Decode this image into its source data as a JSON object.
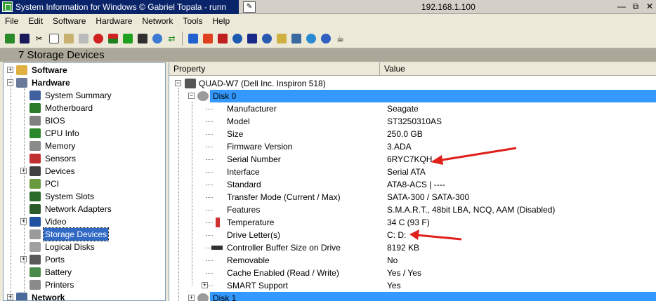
{
  "window": {
    "title": "System Information for Windows  © Gabriel Topala - runn",
    "pin_icon": "pin-icon",
    "remote_address": "192.168.1.100",
    "minimize_glyph": "—",
    "restore_glyph": "⧉",
    "close_glyph": "✕"
  },
  "menu": [
    "File",
    "Edit",
    "Software",
    "Hardware",
    "Network",
    "Tools",
    "Help"
  ],
  "caption": "7 Storage Devices",
  "tree": {
    "items": [
      {
        "label": "Software",
        "bold": true,
        "icon": "software-icon"
      },
      {
        "label": "Hardware",
        "bold": true,
        "icon": "hardware-icon"
      },
      {
        "label": "System Summary",
        "icon": "computer-icon"
      },
      {
        "label": "Motherboard",
        "icon": "motherboard-icon"
      },
      {
        "label": "BIOS",
        "icon": "bios-chip-icon"
      },
      {
        "label": "CPU Info",
        "icon": "cpu-icon"
      },
      {
        "label": "Memory",
        "icon": "memory-icon"
      },
      {
        "label": "Sensors",
        "icon": "thermometer-icon"
      },
      {
        "label": "Devices",
        "icon": "devices-icon"
      },
      {
        "label": "PCI",
        "icon": "pci-card-icon"
      },
      {
        "label": "System Slots",
        "icon": "slots-icon"
      },
      {
        "label": "Network Adapters",
        "icon": "network-adapter-icon"
      },
      {
        "label": "Video",
        "icon": "monitor-icon"
      },
      {
        "label": "Storage Devices",
        "icon": "disk-drive-icon",
        "selected": true
      },
      {
        "label": "Logical Disks",
        "icon": "logical-disk-icon"
      },
      {
        "label": "Ports",
        "icon": "ports-icon"
      },
      {
        "label": "Battery",
        "icon": "battery-icon"
      },
      {
        "label": "Printers",
        "icon": "printer-icon"
      },
      {
        "label": "Network",
        "bold": true,
        "icon": "network-icon"
      }
    ]
  },
  "table": {
    "col_property": "Property",
    "col_value": "Value",
    "computer": "QUAD-W7 (Dell Inc. Inspiron 518)",
    "disk0": "Disk 0",
    "disk1": "Disk 1",
    "rows": [
      {
        "property": "Manufacturer",
        "value": "Seagate"
      },
      {
        "property": "Model",
        "value": "ST3250310AS"
      },
      {
        "property": "Size",
        "value": "250.0 GB"
      },
      {
        "property": "Firmware Version",
        "value": "3.ADA"
      },
      {
        "property": "Serial Number",
        "value": "6RYC7KQH"
      },
      {
        "property": "Interface",
        "value": "Serial ATA"
      },
      {
        "property": "Standard",
        "value": "ATA8-ACS | ----"
      },
      {
        "property": "Transfer Mode (Current / Max)",
        "value": "SATA-300 / SATA-300"
      },
      {
        "property": "Features",
        "value": "S.M.A.R.T., 48bit LBA, NCQ, AAM (Disabled)"
      },
      {
        "property": "Temperature",
        "value": "34 C (93 F)",
        "icon": "thermometer-icon"
      },
      {
        "property": "Drive Letter(s)",
        "value": "C: D:"
      },
      {
        "property": "Controller Buffer Size on Drive",
        "value": "8192 KB",
        "icon": "memory-chip-icon"
      },
      {
        "property": "Removable",
        "value": "No"
      },
      {
        "property": "Cache Enabled (Read / Write)",
        "value": "Yes / Yes"
      },
      {
        "property": "SMART Support",
        "value": "Yes"
      }
    ]
  },
  "colors": {
    "title_bar": "#0a246a",
    "selection": "#316ac5",
    "disk_row": "#3399ff",
    "annotation_arrow": "#e0201b"
  }
}
